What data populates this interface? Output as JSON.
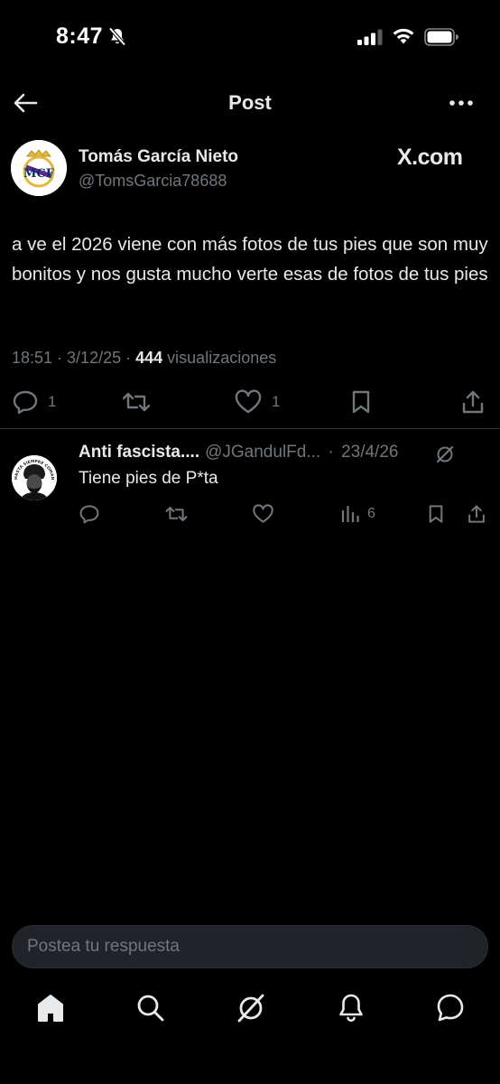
{
  "status_bar": {
    "time": "8:47"
  },
  "header": {
    "title": "Post"
  },
  "post": {
    "author_name": "Tomás García Nieto",
    "author_handle": "@TomsGarcia78688",
    "source": "X.com",
    "text": "a ve el 2026 viene con más fotos de tus pies que son muy bonitos y nos gusta mucho verte esas de fotos de tus pies",
    "time": "18:51",
    "date": "3/12/25",
    "views_count": "444",
    "views_label": "visualizaciones",
    "replies": "1",
    "likes": "1"
  },
  "reply": {
    "name": "Anti fascista....",
    "handle": "@JGandulFd...",
    "date": "23/4/26",
    "text": "Tiene pies de P*ta",
    "views": "6",
    "avatar_text": "HASTA SIEMPRE COMANDANTE"
  },
  "composer": {
    "placeholder": "Postea tu respuesta"
  },
  "colors": {
    "background": "#000000",
    "text": "#e7e9ea",
    "muted": "#71767b",
    "divider": "#2f3336",
    "input_bg": "#202327"
  }
}
